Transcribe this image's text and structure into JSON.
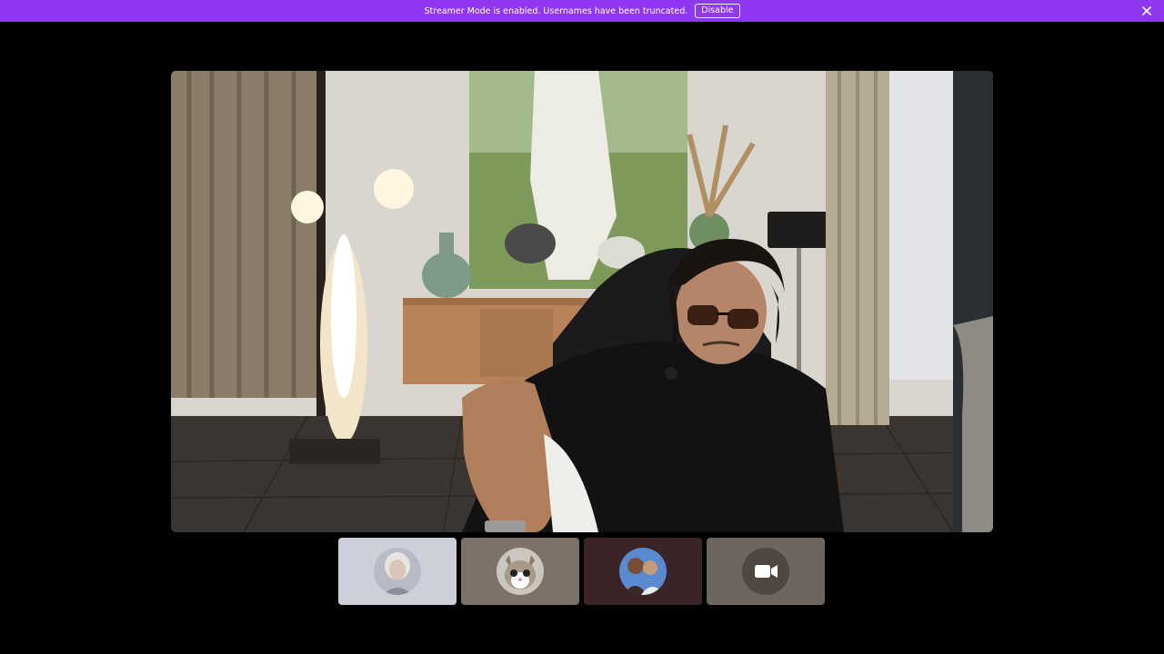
{
  "banner": {
    "message": "Streamer Mode is enabled. Usernames have been truncated.",
    "disable_label": "Disable",
    "background_color": "#8f37f0",
    "close_icon": "close-icon"
  },
  "main_video": {
    "icon": "video-stream"
  },
  "participants": [
    {
      "tile_color": "#cdcfd9",
      "avatar_icon": "avatar-white-haired-woman"
    },
    {
      "tile_color": "#7c7267",
      "avatar_icon": "avatar-cat"
    },
    {
      "tile_color": "#3a2428",
      "avatar_icon": "avatar-couple"
    },
    {
      "tile_color": "#6e655e",
      "avatar_icon": "video-camera-icon"
    }
  ]
}
